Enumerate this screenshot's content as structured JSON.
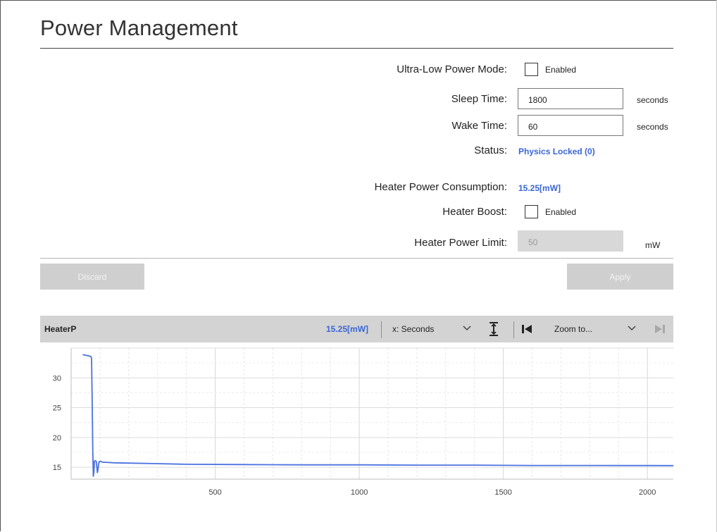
{
  "page": {
    "title": "Power Management"
  },
  "form": {
    "ultra_low_power": {
      "label": "Ultra-Low Power Mode:",
      "checkbox_label": "Enabled",
      "checked": false
    },
    "sleep_time": {
      "label": "Sleep Time:",
      "value": "1800",
      "unit": "seconds"
    },
    "wake_time": {
      "label": "Wake Time:",
      "value": "60",
      "unit": "seconds"
    },
    "status": {
      "label": "Status:",
      "value": "Physics Locked (0)"
    },
    "heater_power": {
      "label": "Heater Power Consumption:",
      "value": "15.25[mW]"
    },
    "heater_boost": {
      "label": "Heater Boost:",
      "checkbox_label": "Enabled",
      "checked": false
    },
    "heater_limit": {
      "label": "Heater Power Limit:",
      "value": "50",
      "unit": "mW"
    }
  },
  "buttons": {
    "discard": "Discard",
    "apply": "Apply"
  },
  "chart_toolbar": {
    "series_name": "HeaterP",
    "current_value": "15.25[mW]",
    "x_axis_select": "x: Seconds",
    "zoom_select": "Zoom to..."
  },
  "colors": {
    "accent": "#3a66d6",
    "toolbar_bg": "#d3d3d3",
    "disabled_button": "#cfcfcf",
    "line": "#4a72e0"
  },
  "icons": [
    "chevron-down-icon",
    "autoscale-icon",
    "skip-to-start-icon",
    "skip-to-end-icon"
  ],
  "chart_data": {
    "type": "line",
    "xlim": [
      0,
      2090
    ],
    "ylim": [
      13,
      35
    ],
    "x_ticks": [
      500,
      1000,
      1500,
      2000
    ],
    "y_ticks": [
      15,
      20,
      25,
      30
    ],
    "grid": true,
    "series": [
      {
        "values_xy": [
          [
            40,
            33.9
          ],
          [
            50,
            33.8
          ],
          [
            60,
            33.7
          ],
          [
            68,
            33.6
          ],
          [
            71,
            33.3
          ],
          [
            73,
            26
          ],
          [
            75,
            18
          ],
          [
            77,
            13.5
          ],
          [
            79,
            14.2
          ],
          [
            81,
            16
          ],
          [
            84,
            16.1
          ],
          [
            87,
            16.0
          ],
          [
            89,
            15.2
          ],
          [
            91,
            14.1
          ],
          [
            93,
            14.5
          ],
          [
            95,
            15.5
          ],
          [
            97,
            15.9
          ],
          [
            102,
            16.0
          ],
          [
            110,
            15.85
          ],
          [
            150,
            15.75
          ],
          [
            200,
            15.7
          ],
          [
            300,
            15.6
          ],
          [
            400,
            15.5
          ],
          [
            600,
            15.45
          ],
          [
            800,
            15.4
          ],
          [
            1000,
            15.4
          ],
          [
            1200,
            15.35
          ],
          [
            1400,
            15.35
          ],
          [
            1600,
            15.3
          ],
          [
            1800,
            15.3
          ],
          [
            2000,
            15.28
          ],
          [
            2090,
            15.27
          ]
        ]
      }
    ]
  }
}
